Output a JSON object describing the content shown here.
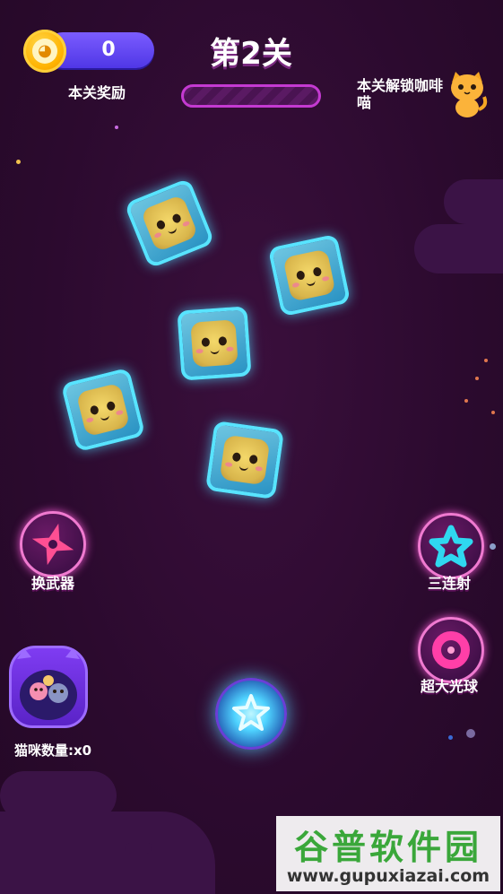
{
  "hud": {
    "coins": "0",
    "reward_label": "本关奖励",
    "level_title": "第2关",
    "level_progress": 0,
    "unlock_label": "本关解锁咖啡喵"
  },
  "powers": {
    "weapon_label": "换武器",
    "triple_label": "三连射",
    "bigball_label": "超大光球"
  },
  "cats": {
    "count_label": "猫咪数量:x0"
  },
  "watermark": {
    "title": "谷普软件园",
    "url": "www.gupuxiazai.com"
  },
  "colors": {
    "background": "#2e0b30",
    "coin_bar": "#5a3cf0",
    "progress_border": "#c43ad1",
    "ice": "#58e4ff",
    "power_ring": "#f07ad0"
  },
  "icons": {
    "coin": "owl-coin-icon",
    "unlock_cat": "orange-cat-icon",
    "weapon": "shuriken-icon",
    "triple": "star-icon",
    "bigball": "donut-icon",
    "launcher": "energy-star-icon"
  }
}
